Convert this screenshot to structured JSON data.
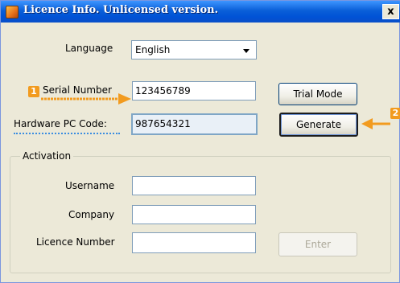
{
  "window": {
    "title": "Licence Info. Unlicensed version.",
    "close_label": "x"
  },
  "language": {
    "label": "Language",
    "selected": "English"
  },
  "serial": {
    "label": "Serial Number",
    "value": "123456789",
    "callout_number": "1"
  },
  "hardware": {
    "label": "Hardware PC Code:",
    "value": "987654321",
    "callout_number": "2"
  },
  "buttons": {
    "trial_mode": "Trial Mode",
    "generate": "Generate",
    "enter": "Enter"
  },
  "activation": {
    "group_label": "Activation",
    "username_label": "Username",
    "username_value": "",
    "company_label": "Company",
    "company_value": "",
    "licence_label": "Licence Number",
    "licence_value": ""
  },
  "colors": {
    "titlebar": "#0a5fd8",
    "callout_orange": "#f29b1f",
    "underline_blue": "#3b8de0"
  }
}
